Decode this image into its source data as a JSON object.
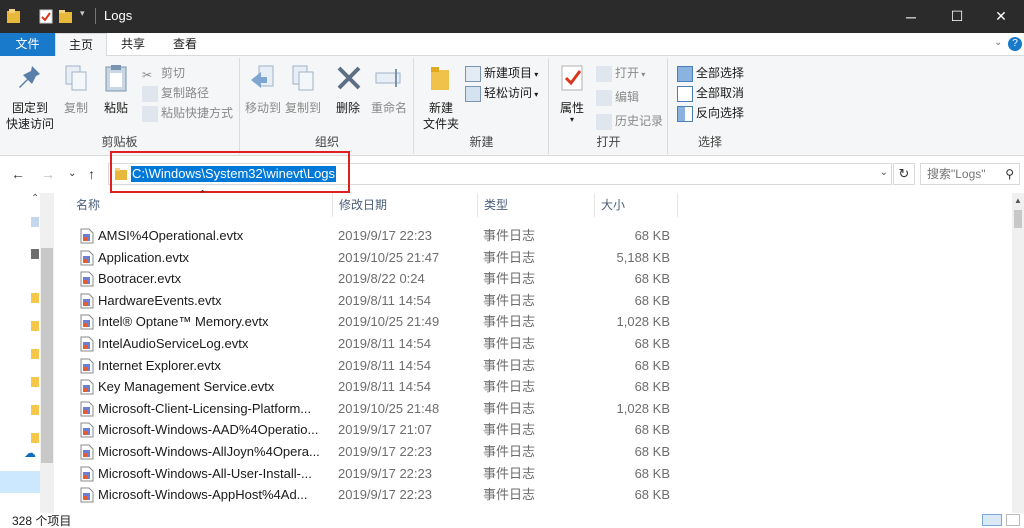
{
  "window": {
    "title": "Logs"
  },
  "ribbon_tabs": {
    "file": "文件",
    "home": "主页",
    "share": "共享",
    "view": "查看"
  },
  "ribbon": {
    "clipboard": {
      "label": "剪贴板",
      "pin_line1": "固定到",
      "pin_line2": "快速访问",
      "copy": "复制",
      "paste": "粘贴",
      "cut": "剪切",
      "copy_path": "复制路径",
      "paste_shortcut": "粘贴快捷方式"
    },
    "organize": {
      "label": "组织",
      "move_to": "移动到",
      "copy_to": "复制到",
      "delete": "删除",
      "rename": "重命名"
    },
    "new": {
      "label": "新建",
      "new_folder_line1": "新建",
      "new_folder_line2": "文件夹",
      "new_item": "新建项目",
      "easy_access": "轻松访问"
    },
    "open": {
      "label": "打开",
      "properties": "属性",
      "open": "打开",
      "edit": "编辑",
      "history": "历史记录"
    },
    "select": {
      "label": "选择",
      "select_all": "全部选择",
      "select_none": "全部取消",
      "invert": "反向选择"
    }
  },
  "address": {
    "path": "C:\\Windows\\System32\\winevt\\Logs"
  },
  "search": {
    "placeholder": "搜索\"Logs\""
  },
  "columns": {
    "name": "名称",
    "date": "修改日期",
    "type": "类型",
    "size": "大小"
  },
  "files": [
    {
      "name": "AMSI%4Operational.evtx",
      "date": "2019/9/17 22:23",
      "type": "事件日志",
      "size": "68 KB"
    },
    {
      "name": "Application.evtx",
      "date": "2019/10/25 21:47",
      "type": "事件日志",
      "size": "5,188 KB"
    },
    {
      "name": "Bootracer.evtx",
      "date": "2019/8/22 0:24",
      "type": "事件日志",
      "size": "68 KB"
    },
    {
      "name": "HardwareEvents.evtx",
      "date": "2019/8/11 14:54",
      "type": "事件日志",
      "size": "68 KB"
    },
    {
      "name": "Intel® Optane™ Memory.evtx",
      "date": "2019/10/25 21:49",
      "type": "事件日志",
      "size": "1,028 KB"
    },
    {
      "name": "IntelAudioServiceLog.evtx",
      "date": "2019/8/11 14:54",
      "type": "事件日志",
      "size": "68 KB"
    },
    {
      "name": "Internet Explorer.evtx",
      "date": "2019/8/11 14:54",
      "type": "事件日志",
      "size": "68 KB"
    },
    {
      "name": "Key Management Service.evtx",
      "date": "2019/8/11 14:54",
      "type": "事件日志",
      "size": "68 KB"
    },
    {
      "name": "Microsoft-Client-Licensing-Platform...",
      "date": "2019/10/25 21:48",
      "type": "事件日志",
      "size": "1,028 KB"
    },
    {
      "name": "Microsoft-Windows-AAD%4Operatio...",
      "date": "2019/9/17 21:07",
      "type": "事件日志",
      "size": "68 KB"
    },
    {
      "name": "Microsoft-Windows-AllJoyn%4Opera...",
      "date": "2019/9/17 22:23",
      "type": "事件日志",
      "size": "68 KB"
    },
    {
      "name": "Microsoft-Windows-All-User-Install-...",
      "date": "2019/9/17 22:23",
      "type": "事件日志",
      "size": "68 KB"
    },
    {
      "name": "Microsoft-Windows-AppHost%4Ad...",
      "date": "2019/9/17 22:23",
      "type": "事件日志",
      "size": "68 KB"
    }
  ],
  "status": {
    "count": "328 个项目"
  }
}
